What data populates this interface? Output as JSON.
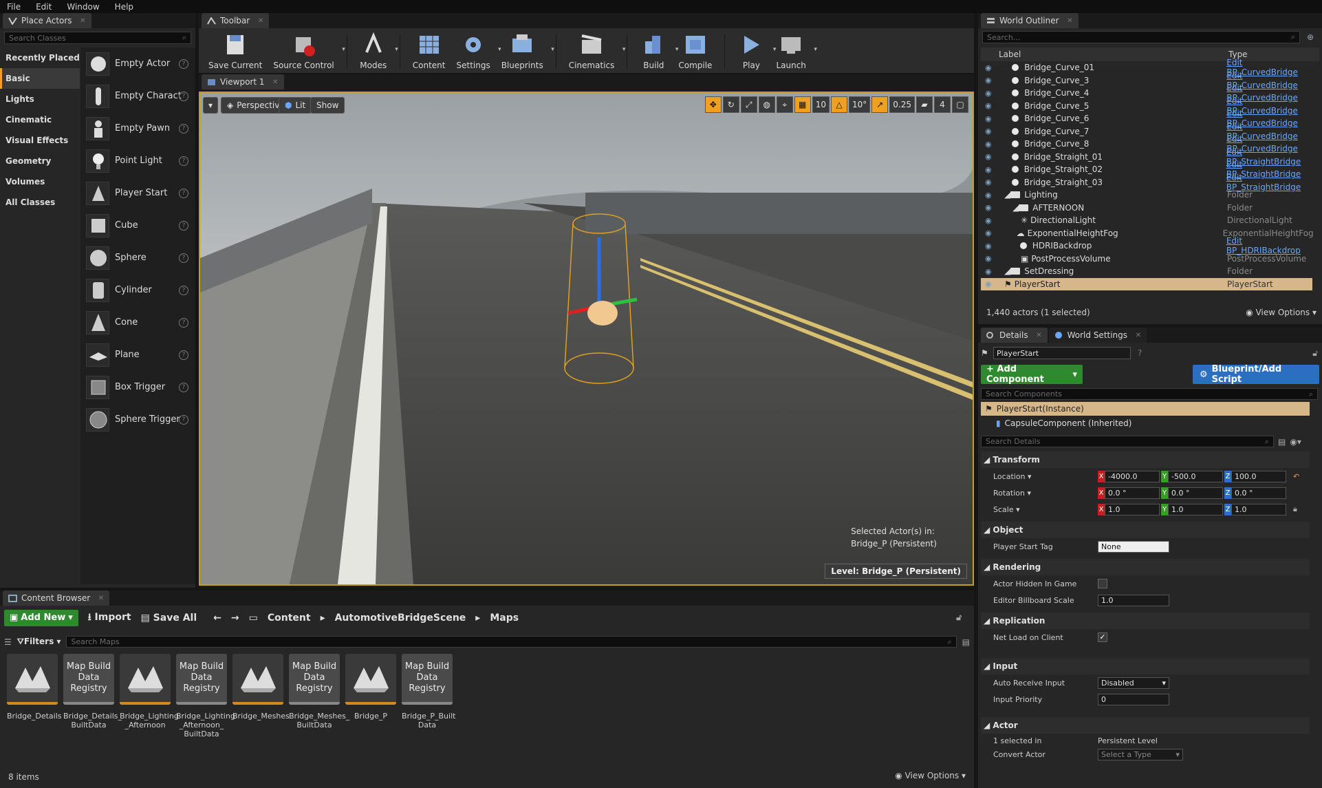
{
  "menu": [
    "File",
    "Edit",
    "Window",
    "Help"
  ],
  "place_actors": {
    "tab": "Place Actors",
    "search_placeholder": "Search Classes",
    "categories": [
      "Recently Placed",
      "Basic",
      "Lights",
      "Cinematic",
      "Visual Effects",
      "Geometry",
      "Volumes",
      "All Classes"
    ],
    "active_category": "Basic",
    "items": [
      "Empty Actor",
      "Empty Charact",
      "Empty Pawn",
      "Point Light",
      "Player Start",
      "Cube",
      "Sphere",
      "Cylinder",
      "Cone",
      "Plane",
      "Box Trigger",
      "Sphere Trigger"
    ]
  },
  "toolbar": {
    "tab": "Toolbar",
    "buttons": [
      {
        "label": "Save Current",
        "icon": "save-icon"
      },
      {
        "label": "Source Control",
        "icon": "source-control-icon"
      },
      {
        "label": "Modes",
        "icon": "modes-icon"
      },
      {
        "label": "Content",
        "icon": "content-icon"
      },
      {
        "label": "Settings",
        "icon": "settings-icon"
      },
      {
        "label": "Blueprints",
        "icon": "blueprints-icon"
      },
      {
        "label": "Cinematics",
        "icon": "cinematics-icon"
      },
      {
        "label": "Build",
        "icon": "build-icon"
      },
      {
        "label": "Compile",
        "icon": "compile-icon"
      },
      {
        "label": "Play",
        "icon": "play-icon"
      },
      {
        "label": "Launch",
        "icon": "launch-icon"
      }
    ]
  },
  "viewport": {
    "tab": "Viewport 1",
    "perspective": "Perspective",
    "lit": "Lit",
    "show": "Show",
    "grid_snap": "10",
    "rotation_snap": "10°",
    "scale_snap": "0.25",
    "camera_speed": "4",
    "selected_info_line1": "Selected Actor(s) in:",
    "selected_info_line2": "Bridge_P (Persistent)",
    "level_label": "Level:",
    "level_name": "Bridge_P (Persistent)"
  },
  "outliner": {
    "tab": "World Outliner",
    "search_placeholder": "Search...",
    "col_label": "Label",
    "col_type": "Type",
    "rows": [
      {
        "label": "Bridge_Curve_01",
        "type": "Edit BP_CurvedBridge",
        "link": true,
        "indent": 2,
        "kind": "dot"
      },
      {
        "label": "Bridge_Curve_3",
        "type": "Edit BP_CurvedBridge",
        "link": true,
        "indent": 2,
        "kind": "dot"
      },
      {
        "label": "Bridge_Curve_4",
        "type": "Edit BP_CurvedBridge",
        "link": true,
        "indent": 2,
        "kind": "dot"
      },
      {
        "label": "Bridge_Curve_5",
        "type": "Edit BP_CurvedBridge",
        "link": true,
        "indent": 2,
        "kind": "dot"
      },
      {
        "label": "Bridge_Curve_6",
        "type": "Edit BP_CurvedBridge",
        "link": true,
        "indent": 2,
        "kind": "dot"
      },
      {
        "label": "Bridge_Curve_7",
        "type": "Edit BP_CurvedBridge",
        "link": true,
        "indent": 2,
        "kind": "dot"
      },
      {
        "label": "Bridge_Curve_8",
        "type": "Edit BP_CurvedBridge",
        "link": true,
        "indent": 2,
        "kind": "dot"
      },
      {
        "label": "Bridge_Straight_01",
        "type": "Edit BP_StraightBridge",
        "link": true,
        "indent": 2,
        "kind": "dot"
      },
      {
        "label": "Bridge_Straight_02",
        "type": "Edit BP_StraightBridge",
        "link": true,
        "indent": 2,
        "kind": "dot"
      },
      {
        "label": "Bridge_Straight_03",
        "type": "Edit BP_StraightBridge",
        "link": true,
        "indent": 2,
        "kind": "dot"
      },
      {
        "label": "Lighting",
        "type": "Folder",
        "link": false,
        "indent": 1,
        "kind": "folder"
      },
      {
        "label": "AFTERNOON",
        "type": "Folder",
        "link": false,
        "indent": 2,
        "kind": "folder"
      },
      {
        "label": "DirectionalLight",
        "type": "DirectionalLight",
        "link": false,
        "indent": 3,
        "kind": "light"
      },
      {
        "label": "ExponentialHeightFog",
        "type": "ExponentialHeightFog",
        "link": false,
        "indent": 3,
        "kind": "fog"
      },
      {
        "label": "HDRIBackdrop",
        "type": "Edit BP_HDRIBackdrop",
        "link": true,
        "indent": 3,
        "kind": "dot"
      },
      {
        "label": "PostProcessVolume",
        "type": "PostProcessVolume",
        "link": false,
        "indent": 3,
        "kind": "volume"
      },
      {
        "label": "SetDressing",
        "type": "Folder",
        "link": false,
        "indent": 1,
        "kind": "folder"
      },
      {
        "label": "PlayerStart",
        "type": "PlayerStart",
        "link": false,
        "indent": 1,
        "kind": "player",
        "selected": true
      }
    ],
    "count": "1,440 actors (1 selected)",
    "view_options": "View Options"
  },
  "details": {
    "tab_details": "Details",
    "tab_world": "World Settings",
    "name": "PlayerStart",
    "add_component": "+ Add Component",
    "blueprint": "Blueprint/Add Script",
    "search_components": "Search Components",
    "instance": "PlayerStart(Instance)",
    "capsule": "CapsuleComponent (Inherited)",
    "search_details": "Search Details",
    "transform": "Transform",
    "location_label": "Location",
    "rotation_label": "Rotation",
    "scale_label": "Scale",
    "location": [
      "-4000.0",
      "-500.0",
      "100.0"
    ],
    "rotation": [
      "0.0 °",
      "0.0 °",
      "0.0 °"
    ],
    "scale": [
      "1.0",
      "1.0",
      "1.0"
    ],
    "object": "Object",
    "player_start_tag_label": "Player Start Tag",
    "player_start_tag": "None",
    "rendering": "Rendering",
    "hidden_label": "Actor Hidden In Game",
    "billboard_label": "Editor Billboard Scale",
    "billboard": "1.0",
    "replication": "Replication",
    "netload_label": "Net Load on Client",
    "input": "Input",
    "auto_receive_label": "Auto Receive Input",
    "auto_receive": "Disabled",
    "input_priority_label": "Input Priority",
    "input_priority": "0",
    "actor": "Actor",
    "selected_in_label": "1 selected in",
    "selected_in": "Persistent Level",
    "convert_label": "Convert Actor",
    "convert": "Select a Type"
  },
  "content_browser": {
    "tab": "Content Browser",
    "add_new": "Add New",
    "import": "Import",
    "save_all": "Save All",
    "path": [
      "Content",
      "AutomotiveBridgeScene",
      "Maps"
    ],
    "filters": "Filters",
    "search_placeholder": "Search Maps",
    "assets": [
      {
        "name": "Bridge_Details",
        "kind": "map"
      },
      {
        "name": "Bridge_Details_ BuiltData",
        "kind": "reg"
      },
      {
        "name": "Bridge_Lighting _Afternoon",
        "kind": "map"
      },
      {
        "name": "Bridge_Lighting _Afternoon_ BuiltData",
        "kind": "reg"
      },
      {
        "name": "Bridge_Meshes",
        "kind": "map"
      },
      {
        "name": "Bridge_Meshes_ BuiltData",
        "kind": "reg"
      },
      {
        "name": "Bridge_P",
        "kind": "map"
      },
      {
        "name": "Bridge_P_Built Data",
        "kind": "reg"
      }
    ],
    "registry_label": "Map Build Data Registry",
    "item_count": "8 items",
    "view_options": "View Options"
  }
}
